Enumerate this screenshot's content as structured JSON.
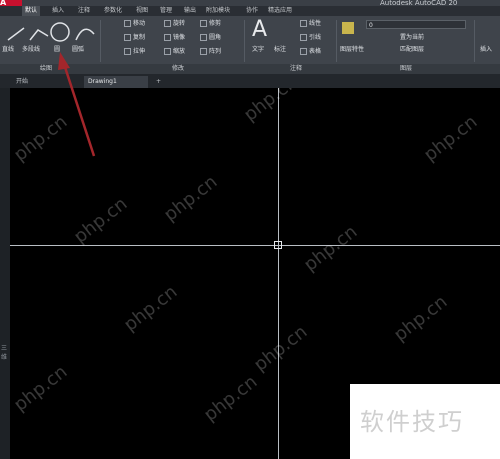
{
  "app": {
    "logo": "A",
    "title": "Autodesk AutoCAD 20"
  },
  "ribbon_tabs": [
    "默认",
    "插入",
    "注释",
    "参数化",
    "视图",
    "管理",
    "输出",
    "附加模块",
    "协作",
    "精选应用"
  ],
  "ribbon": {
    "draw": {
      "label": "绘图",
      "buttons": [
        "直线",
        "多段线",
        "圆",
        "圆弧"
      ]
    },
    "modify": {
      "label": "修改",
      "buttons": [
        "移动",
        "旋转",
        "修剪",
        "复制",
        "镜像",
        "圆角",
        "拉伸",
        "缩放",
        "阵列"
      ]
    },
    "annotation": {
      "label": "注释",
      "buttons": [
        "文字",
        "标注",
        "线性",
        "引线",
        "表格"
      ]
    },
    "layers": {
      "label": "图层",
      "buttons": [
        "图层特性",
        "置为当前",
        "匹配图层"
      ],
      "current_layer": "0"
    },
    "block": {
      "buttons": [
        "插入"
      ]
    }
  },
  "doc_tabs": {
    "start": "开始",
    "drawing": "Drawing1",
    "add": "+"
  },
  "sidebar_label": "三维",
  "watermark_text": "php.cn",
  "corner_badge": "软件技巧",
  "colors": {
    "accent_red": "#c8102e",
    "arrow_red": "#a3262b",
    "crosshair": "#b9bec4"
  }
}
